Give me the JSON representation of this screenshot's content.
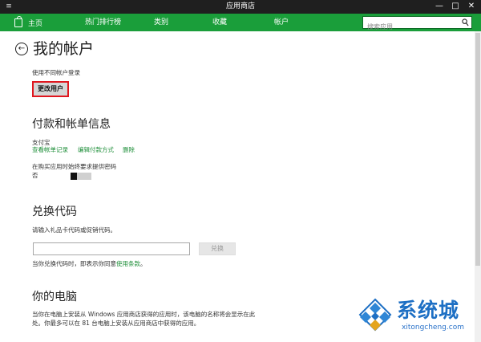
{
  "titlebar": {
    "menu_glyph": "≡",
    "title": "应用商店",
    "minimize": "—",
    "maximize": "□",
    "close": "✕"
  },
  "nav": {
    "items": [
      {
        "label": "主页"
      },
      {
        "label": "热门排行榜"
      },
      {
        "label": "类别"
      },
      {
        "label": "收藏"
      },
      {
        "label": "帐户"
      }
    ],
    "search_placeholder": "搜索应用"
  },
  "page": {
    "back_glyph": "←",
    "title": "我的帐户"
  },
  "account": {
    "switch_label": "使用不同帐户登录",
    "change_user_button": "更改用户"
  },
  "payment": {
    "title": "付款和帐单信息",
    "method": "支付宝",
    "links": [
      "查看帐单记录",
      "编辑付款方式",
      "删除"
    ],
    "password_setting_label": "在购买应用时始终要求提供密码",
    "password_setting_value": "否",
    "password_toggle_on": false
  },
  "redeem": {
    "title": "兑换代码",
    "prompt": "请输入礼品卡代码或促销代码。",
    "input_value": "",
    "button": "兑换",
    "terms_prefix": "当你兑换代码时，即表示你同意",
    "terms_link": "使用条款",
    "terms_suffix": "。"
  },
  "pc": {
    "title": "你的电脑",
    "desc_line1": "当你在电脑上安装从 Windows 应用商店获得的应用时，该电脑的名称将会显示在此",
    "desc_line2": "处。你最多可以在 81 台电脑上安装从应用商店中获得的应用。"
  },
  "watermark": {
    "brand": "系统城",
    "url": "xitongcheng.com"
  },
  "colors": {
    "nav_green": "#1a9e3a",
    "link_green": "#1f8f3a",
    "highlight_red": "#e0161e",
    "watermark_blue": "#1d6fc4"
  }
}
